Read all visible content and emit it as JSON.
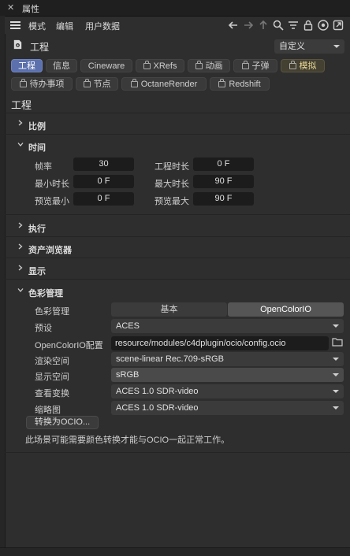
{
  "window": {
    "close": "✕",
    "title": "属性"
  },
  "menu": {
    "mode": "模式",
    "edit": "编辑",
    "userdata": "用户数据"
  },
  "object": {
    "name": "工程",
    "preset": "自定义"
  },
  "tabs_row1": [
    {
      "label": "工程",
      "active": true
    },
    {
      "label": "信息"
    },
    {
      "label": "Cineware"
    },
    {
      "label": "XRefs",
      "lock": true
    },
    {
      "label": "动画",
      "lock": true
    },
    {
      "label": "子弹",
      "lock": true
    },
    {
      "label": "模拟",
      "lock": true,
      "yellow": true
    }
  ],
  "tabs_row2": [
    {
      "label": "待办事项",
      "lock": true
    },
    {
      "label": "节点",
      "lock": true
    },
    {
      "label": "OctaneRender",
      "lock": true
    },
    {
      "label": "Redshift",
      "lock": true
    }
  ],
  "section": {
    "title": "工程"
  },
  "groups": {
    "scale": "比例",
    "time": "时间",
    "execute": "执行",
    "asset_browser": "资产浏览器",
    "display": "显示",
    "color_mgmt": "色彩管理"
  },
  "time": {
    "fps_label": "帧率",
    "fps": "30",
    "proj_len_label": "工程时长",
    "proj_len": "0 F",
    "min_len_label": "最小时长",
    "min_len": "0 F",
    "max_len_label": "最大时长",
    "max_len": "90 F",
    "prev_min_label": "预览最小",
    "prev_min": "0 F",
    "prev_max_label": "预览最大",
    "prev_max": "90 F"
  },
  "color": {
    "mgmt_label": "色彩管理",
    "mode_basic": "基本",
    "mode_ocio": "OpenColorIO",
    "preset_label": "预设",
    "preset": "ACES",
    "config_label": "OpenColorIO配置",
    "config": "resource/modules/c4dplugin/ocio/config.ocio",
    "render_label": "渲染空间",
    "render": "scene-linear Rec.709-sRGB",
    "display_label": "显示空间",
    "display": "sRGB",
    "view_label": "查看变换",
    "view": "ACES 1.0 SDR-video",
    "thumb_label": "缩略图",
    "thumb": "ACES 1.0 SDR-video",
    "convert_btn": "转换为OCIO...",
    "note": "此场景可能需要颜色转换才能与OCIO一起正常工作。"
  },
  "colors": {
    "accent": "#5b70ad",
    "bg": "#2e2e2e"
  }
}
